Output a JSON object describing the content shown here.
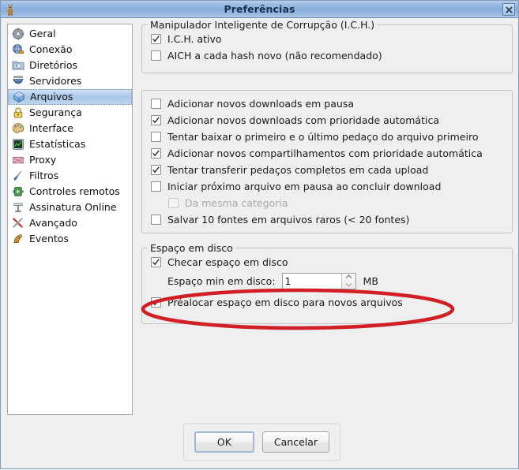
{
  "window": {
    "title": "Preferências",
    "icon": "emule-donkey-icon",
    "close_label": "×"
  },
  "sidebar": {
    "items": [
      {
        "label": "Geral",
        "icon": "gear-icon",
        "selected": false
      },
      {
        "label": "Conexão",
        "icon": "globe-plug-icon",
        "selected": false
      },
      {
        "label": "Diretórios",
        "icon": "folder-icon",
        "selected": false
      },
      {
        "label": "Servidores",
        "icon": "server-globe-icon",
        "selected": false
      },
      {
        "label": "Arquivos",
        "icon": "file-cube-icon",
        "selected": true
      },
      {
        "label": "Segurança",
        "icon": "lock-icon",
        "selected": false
      },
      {
        "label": "Interface",
        "icon": "palette-icon",
        "selected": false
      },
      {
        "label": "Estatísticas",
        "icon": "chart-icon",
        "selected": false
      },
      {
        "label": "Proxy",
        "icon": "proxy-icon",
        "selected": false
      },
      {
        "label": "Filtros",
        "icon": "filter-icon",
        "selected": false
      },
      {
        "label": "Controles remotos",
        "icon": "remote-control-icon",
        "selected": false
      },
      {
        "label": "Assinatura Online",
        "icon": "signature-icon",
        "selected": false
      },
      {
        "label": "Avançado",
        "icon": "tools-icon",
        "selected": false
      },
      {
        "label": "Eventos",
        "icon": "events-icon",
        "selected": false
      }
    ]
  },
  "groups": {
    "ich": {
      "title": "Manipulador Inteligente de Corrupção (I.C.H.)",
      "options": [
        {
          "label": "I.C.H. ativo",
          "checked": true,
          "disabled": false
        },
        {
          "label": "AICH a cada hash novo (não recomendado)",
          "checked": false,
          "disabled": false
        }
      ]
    },
    "downloads": {
      "title": "",
      "options": [
        {
          "label": "Adicionar novos downloads em pausa",
          "checked": false,
          "disabled": false
        },
        {
          "label": "Adicionar novos downloads com prioridade automática",
          "checked": true,
          "disabled": false
        },
        {
          "label": "Tentar baixar o primeiro e o último pedaço do arquivo primeiro",
          "checked": false,
          "disabled": false
        },
        {
          "label": "Adicionar novos compartilhamentos com prioridade automática",
          "checked": true,
          "disabled": false
        },
        {
          "label": "Tentar transferir pedaços completos em cada upload",
          "checked": true,
          "disabled": false
        },
        {
          "label": "Iniciar próximo arquivo em pausa ao concluir download",
          "checked": false,
          "disabled": false
        },
        {
          "label": "Da mesma categoria",
          "checked": false,
          "disabled": true,
          "indent": true
        },
        {
          "label": "Salvar 10 fontes em arquivos raros (< 20 fontes)",
          "checked": false,
          "disabled": false
        }
      ]
    },
    "disk": {
      "title": "Espaço em disco",
      "check_disk": {
        "label": "Checar espaço em disco",
        "checked": true
      },
      "min_space": {
        "label": "Espaço min em disco:",
        "value": "1",
        "unit": "MB",
        "spinner_up": "up-arrow-icon",
        "spinner_down": "down-arrow-icon"
      },
      "prealloc": {
        "label": "Préalocar espaço em disco para novos arquivos",
        "checked": true
      }
    }
  },
  "annotation": {
    "shape": "ellipse",
    "color": "#d21f26",
    "target": "Préalocar espaço em disco para novos arquivos"
  },
  "buttons": {
    "ok": "OK",
    "cancel": "Cancelar"
  },
  "colors": {
    "titlebar_blue": "#87aeda",
    "selection_blue": "#a9c7e8",
    "annotation_red": "#d21f26",
    "window_bg": "#efefef"
  }
}
